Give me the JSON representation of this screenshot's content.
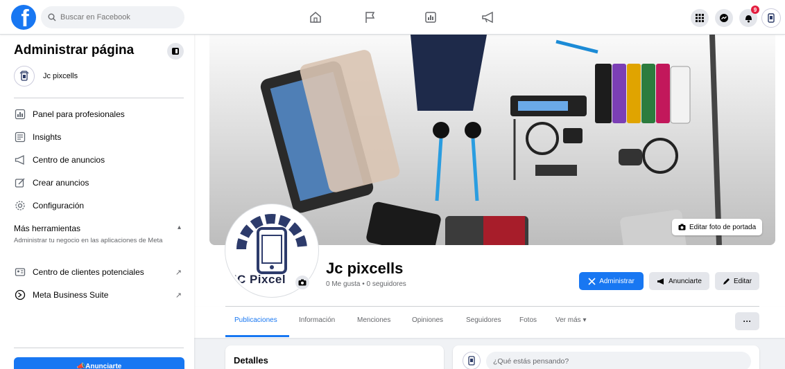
{
  "header": {
    "search_placeholder": "Buscar en Facebook",
    "notification_count": "9"
  },
  "sidebar": {
    "title": "Administrar página",
    "page_name": "Jc pixcells",
    "items": [
      {
        "label": "Panel para profesionales",
        "icon": "dashboard-icon"
      },
      {
        "label": "Insights",
        "icon": "insights-icon"
      },
      {
        "label": "Centro de anuncios",
        "icon": "megaphone-icon"
      },
      {
        "label": "Crear anuncios",
        "icon": "pencil-square-icon"
      },
      {
        "label": "Configuración",
        "icon": "gear-icon"
      }
    ],
    "more_tools_title": "Más herramientas",
    "more_tools_subtitle": "Administrar tu negocio en las aplicaciones de Meta",
    "tools": [
      {
        "label": "Centro de clientes potenciales",
        "icon": "contact-card-icon"
      },
      {
        "label": "Meta Business Suite",
        "icon": "meta-icon"
      }
    ],
    "cta_label": "Anunciarte"
  },
  "profile": {
    "logo_text": "JC Pixcel",
    "name": "Jc pixcells",
    "stats": "0 Me gusta • 0 seguidores",
    "edit_cover_label": "Editar foto de portada",
    "administrar_label": "Administrar",
    "anunciarte_label": "Anunciarte",
    "editar_label": "Editar"
  },
  "tabs": [
    {
      "label": "Publicaciones"
    },
    {
      "label": "Información"
    },
    {
      "label": "Menciones"
    },
    {
      "label": "Opiniones"
    },
    {
      "label": "Seguidores"
    },
    {
      "label": "Fotos"
    },
    {
      "label": "Ver más ▾"
    }
  ],
  "tab_more_label": "···",
  "details_title": "Detalles",
  "compose_placeholder": "¿Qué estás pensando?",
  "colors": {
    "brand": "#1877f2",
    "badge": "#e41e3f"
  }
}
